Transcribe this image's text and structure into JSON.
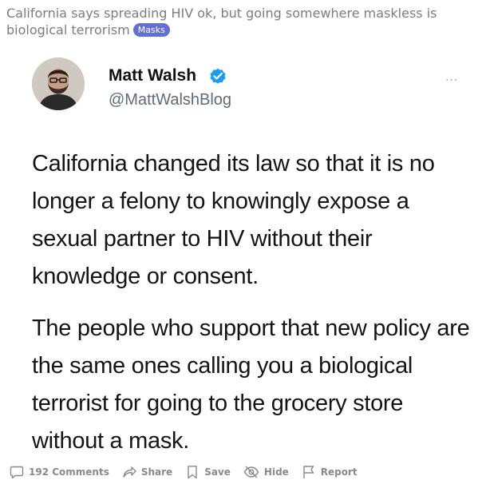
{
  "post": {
    "title": "California says spreading HIV ok, but going somewhere maskless is biological terrorism",
    "flair": "Masks"
  },
  "tweet": {
    "author_name": "Matt Walsh",
    "author_handle": "@MattWalshBlog",
    "more_label": "...",
    "paragraphs": [
      "California changed its law so that it is no longer a felony to knowingly expose a sexual partner to HIV without their knowledge or consent.",
      "The people who support that new policy are the same ones calling you a biological terrorist for going to the grocery store without a mask."
    ]
  },
  "actions": {
    "comments": "192 Comments",
    "share": "Share",
    "save": "Save",
    "hide": "Hide",
    "report": "Report"
  },
  "colors": {
    "flair_bg": "#646fd4",
    "verified_blue": "#1d9bf0",
    "action_gray": "#878a8c"
  },
  "icons": [
    "verified-badge-icon",
    "comment-icon",
    "share-icon",
    "bookmark-icon",
    "hide-eye-icon",
    "flag-icon",
    "more-icon"
  ]
}
